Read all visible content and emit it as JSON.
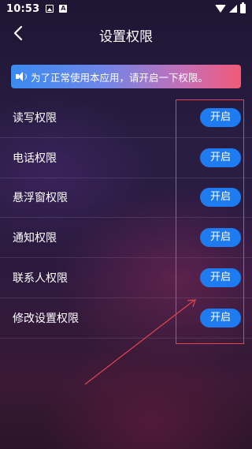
{
  "status_bar": {
    "time": "10:53",
    "left_icons": [
      "image-icon",
      "a-icon"
    ],
    "right_icons": [
      "wifi-icon",
      "signal-icon",
      "battery-icon"
    ]
  },
  "header": {
    "title": "设置权限",
    "back_icon": "chevron-left-icon"
  },
  "notice": {
    "icon": "speaker-icon",
    "text": "为了正常使用本应用，请开启一下权限。",
    "gradient": [
      "#3a8bf0",
      "#f05a78"
    ]
  },
  "permissions": [
    {
      "label": "读写权限",
      "button": "开启"
    },
    {
      "label": "电话权限",
      "button": "开启"
    },
    {
      "label": "悬浮窗权限",
      "button": "开启"
    },
    {
      "label": "通知权限",
      "button": "开启"
    },
    {
      "label": "联系人权限",
      "button": "开启"
    },
    {
      "label": "修改设置权限",
      "button": "开启"
    }
  ],
  "colors": {
    "button": "#1e7cf0",
    "annotation": "#e2474e"
  }
}
